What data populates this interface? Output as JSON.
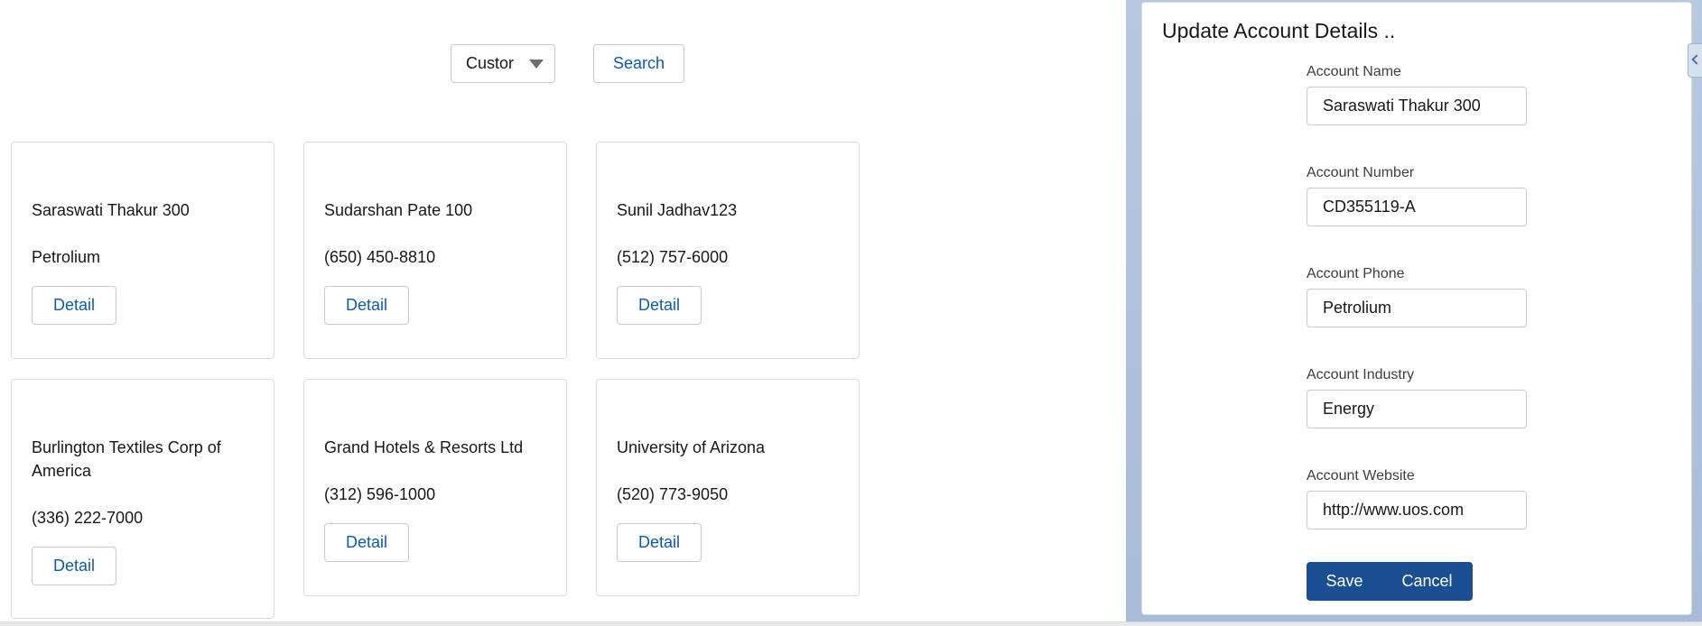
{
  "search": {
    "filter_value": "Custor",
    "search_label": "Search"
  },
  "accounts": [
    {
      "name": "Saraswati Thakur 300",
      "sub": "Petrolium",
      "detail_label": "Detail"
    },
    {
      "name": "Sudarshan Pate 100",
      "sub": "(650) 450-8810",
      "detail_label": "Detail"
    },
    {
      "name": "Sunil Jadhav123",
      "sub": "(512) 757-6000",
      "detail_label": "Detail"
    },
    {
      "name": "Burlington Textiles Corp of America",
      "sub": "(336) 222-7000",
      "detail_label": "Detail"
    },
    {
      "name": "Grand Hotels & Resorts Ltd",
      "sub": "(312) 596-1000",
      "detail_label": "Detail"
    },
    {
      "name": "University of Arizona",
      "sub": "(520) 773-9050",
      "detail_label": "Detail"
    }
  ],
  "modal": {
    "title": "Update Account Details ..",
    "fields": [
      {
        "label": "Account Name",
        "value": "Saraswati Thakur 300"
      },
      {
        "label": "Account Number",
        "value": "CD355119-A"
      },
      {
        "label": "Account Phone",
        "value": "Petrolium"
      },
      {
        "label": "Account Industry",
        "value": "Energy"
      },
      {
        "label": "Account Website",
        "value": "http://www.uos.com"
      }
    ],
    "save_label": "Save",
    "cancel_label": "Cancel"
  },
  "colors": {
    "brand": "#1b4f93",
    "link": "#0b5cab",
    "background": "#b0c4df"
  },
  "icons": {
    "filter_caret": "chevron-down-icon",
    "side_tab": "chevron-left-icon"
  }
}
